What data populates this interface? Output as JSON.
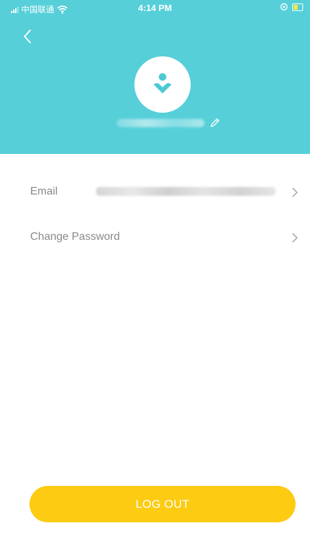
{
  "status_bar": {
    "carrier": "中国联通",
    "time": "4:14 PM"
  },
  "profile": {
    "back_label": "Back",
    "username_hidden": true
  },
  "account_rows": [
    {
      "label": "Email",
      "value_blurred": true
    },
    {
      "label": "Change Password"
    }
  ],
  "logout": {
    "label": "LOG OUT"
  },
  "colors": {
    "header_bg": "#56cfd9",
    "accent_teal": "#4ec9d4",
    "logout_bg": "#fccb12",
    "label_text": "#888888"
  },
  "icons": {
    "back": "chevron-left-icon",
    "avatar": "user-avatar-icon",
    "edit": "pencil-icon",
    "row_chevron": "chevron-right-icon",
    "wifi": "wifi-icon",
    "battery": "battery-charging-icon",
    "location": "location-lock-icon"
  }
}
